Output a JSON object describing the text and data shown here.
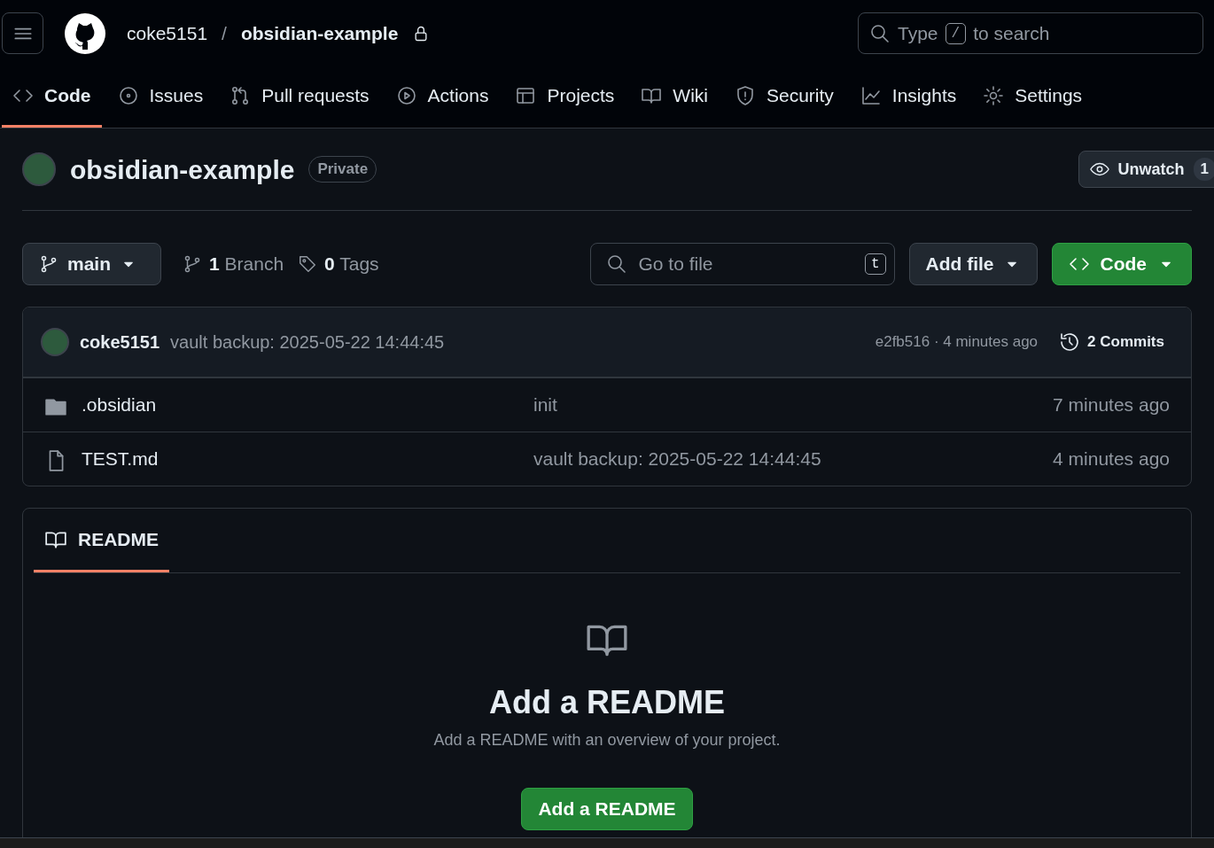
{
  "header": {
    "owner": "coke5151",
    "separator": "/",
    "repo_name": "obsidian-example",
    "search": {
      "before": "Type",
      "key": "/",
      "after": "to search"
    }
  },
  "tabs": [
    {
      "kind": "code",
      "label": "Code",
      "selected": true
    },
    {
      "kind": "issues",
      "label": "Issues",
      "selected": false
    },
    {
      "kind": "pulls",
      "label": "Pull requests",
      "selected": false
    },
    {
      "kind": "actions",
      "label": "Actions",
      "selected": false
    },
    {
      "kind": "projects",
      "label": "Projects",
      "selected": false
    },
    {
      "kind": "wiki",
      "label": "Wiki",
      "selected": false
    },
    {
      "kind": "security",
      "label": "Security",
      "selected": false
    },
    {
      "kind": "insights",
      "label": "Insights",
      "selected": false
    },
    {
      "kind": "settings",
      "label": "Settings",
      "selected": false
    }
  ],
  "repo": {
    "title": "obsidian-example",
    "visibility": "Private",
    "watch": {
      "label": "Unwatch",
      "count": "1"
    }
  },
  "toolbar": {
    "branch": "main",
    "branches": {
      "count": "1",
      "label": "Branch"
    },
    "tags": {
      "count": "0",
      "label": "Tags"
    },
    "file_search": {
      "placeholder": "Go to file",
      "shortcut": "t"
    },
    "add_file": "Add file",
    "code_button": "Code"
  },
  "commit": {
    "author": "coke5151",
    "message": "vault backup: 2025-05-22 14:44:45",
    "hash_time": "e2fb516 · 4 minutes ago",
    "commits": {
      "count": "2",
      "label": "Commits"
    }
  },
  "files": [
    {
      "kind": "folder",
      "name": ".obsidian",
      "message": "init",
      "time": "7 minutes ago"
    },
    {
      "kind": "file",
      "name": "TEST.md",
      "message": "vault backup: 2025-05-22 14:44:45",
      "time": "4 minutes ago"
    }
  ],
  "readme": {
    "tab": {
      "label": "README",
      "selected": true
    },
    "heading": "Add a README",
    "description": "Add a README with an overview of your project.",
    "button": "Add a README"
  }
}
